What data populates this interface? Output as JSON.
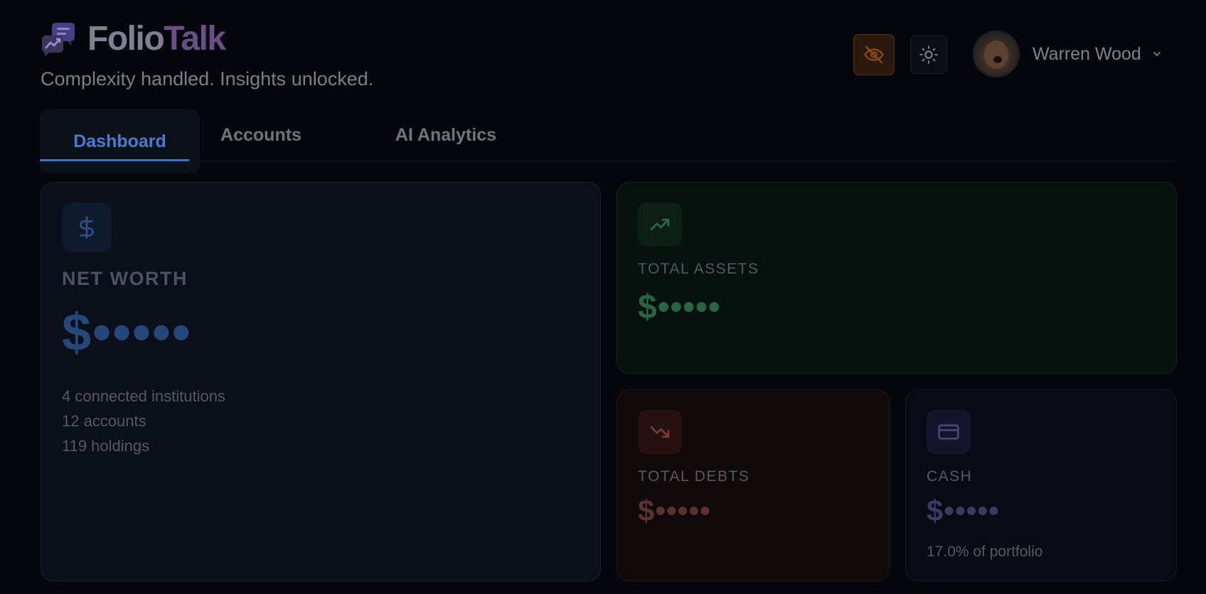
{
  "header": {
    "brand_part1": "Folio",
    "brand_part2": "Talk",
    "tagline": "Complexity handled. Insights unlocked.",
    "user_name": "Warren Wood"
  },
  "tabs": [
    {
      "label": "Dashboard",
      "active": true
    },
    {
      "label": "Accounts",
      "active": false
    },
    {
      "label": "AI Analytics",
      "active": false
    }
  ],
  "cards": {
    "net_worth": {
      "icon": "dollar-icon",
      "label": "NET WORTH",
      "value": "$•••••",
      "institutions": "4 connected institutions",
      "accounts": "12 accounts",
      "holdings": "119 holdings"
    },
    "total_assets": {
      "icon": "trending-up-icon",
      "label": "TOTAL ASSETS",
      "value": "$•••••"
    },
    "total_debts": {
      "icon": "trending-down-icon",
      "label": "TOTAL DEBTS",
      "value": "$•••••"
    },
    "cash": {
      "icon": "credit-card-icon",
      "label": "CASH",
      "value": "$•••••",
      "subtext": "17.0% of portfolio"
    }
  },
  "colors": {
    "background": "#06070c",
    "accent_blue": "#4c7ad3",
    "assets_green": "#2b6345",
    "debts_red": "#5e3130",
    "cash_purple": "#3d3a62",
    "privacy_orange": "#8a4a1c"
  }
}
